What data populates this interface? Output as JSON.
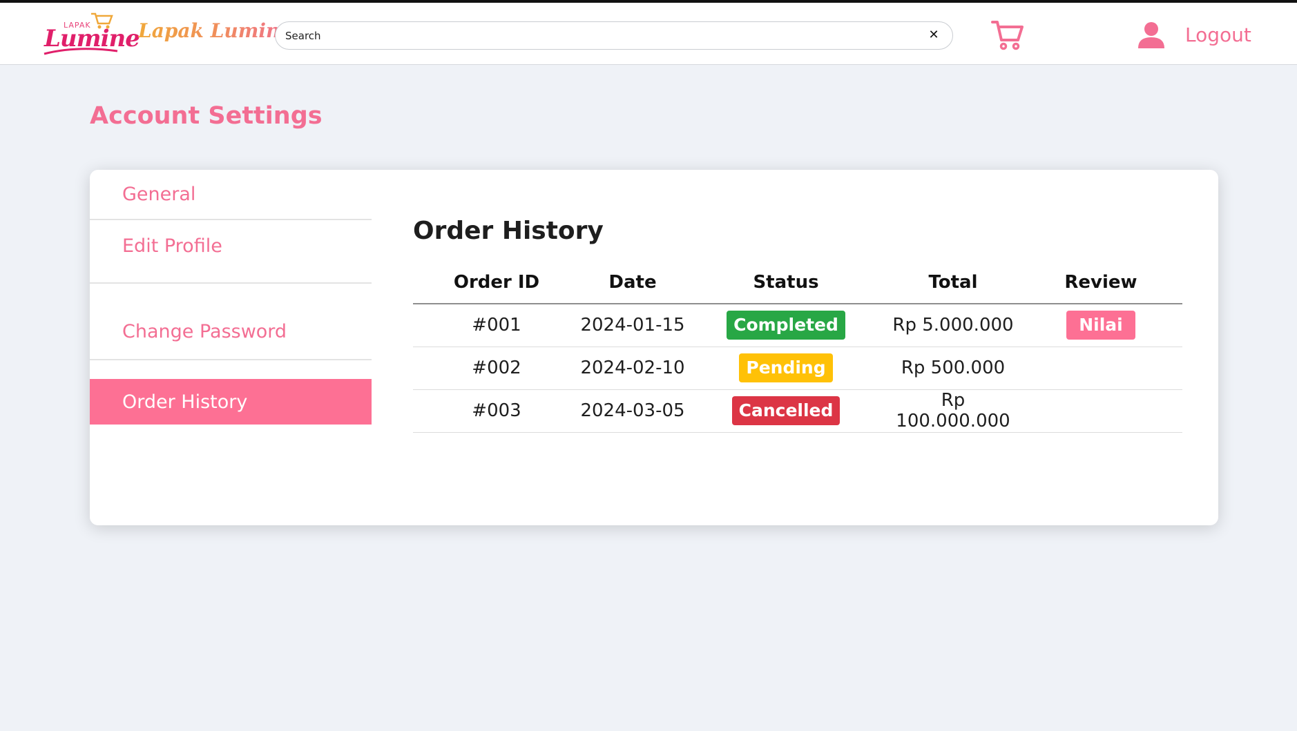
{
  "header": {
    "logo_small_text": "LAPAK",
    "logo_script_text": "Lumine",
    "brand_name": "Lapak Lumine",
    "search_placeholder": "Search",
    "search_clear": "✕",
    "logout_label": "Logout",
    "icons": {
      "cart": "cart-icon",
      "user": "user-icon",
      "clear": "close-icon"
    }
  },
  "page": {
    "title": "Account Settings"
  },
  "sidebar": {
    "items": [
      {
        "label": "General",
        "active": false
      },
      {
        "label": "Edit Profile",
        "active": false
      },
      {
        "label": "Change Password",
        "active": false
      },
      {
        "label": "Order History",
        "active": true
      }
    ]
  },
  "orders": {
    "title": "Order History",
    "columns": [
      "Order ID",
      "Date",
      "Status",
      "Total",
      "Review"
    ],
    "rows": [
      {
        "id": "#001",
        "date": "2024-01-15",
        "status": "Completed",
        "total": "Rp 5.000.000",
        "review": "Nilai"
      },
      {
        "id": "#002",
        "date": "2024-02-10",
        "status": "Pending",
        "total": "Rp 500.000",
        "review": ""
      },
      {
        "id": "#003",
        "date": "2024-03-05",
        "status": "Cancelled",
        "total": "Rp 100.000.000",
        "review": ""
      }
    ]
  },
  "colors": {
    "accent": "#f36e93",
    "active_bg": "#fd7094",
    "completed": "#28a745",
    "pending": "#ffc107",
    "cancelled": "#dc3545",
    "background": "#eff2f7"
  }
}
